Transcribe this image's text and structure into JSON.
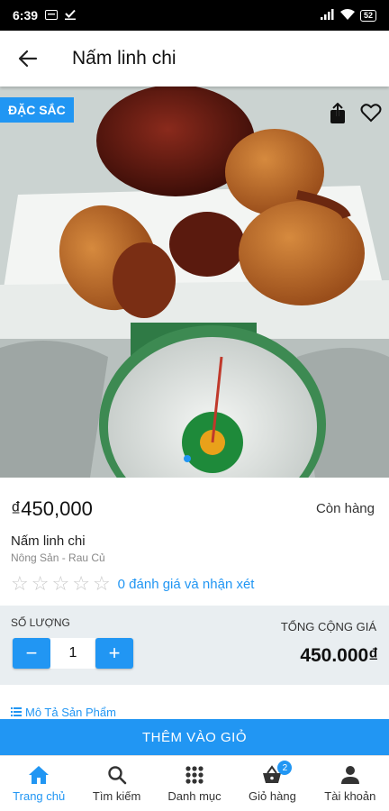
{
  "status_bar": {
    "time": "6:39",
    "battery": "52"
  },
  "app_bar": {
    "title": "Nấm linh chi"
  },
  "product": {
    "badge": "ĐẶC SẮC",
    "price": "₫450,000",
    "stock_status": "Còn hàng",
    "name": "Nấm linh chi",
    "category": "Nông Sản - Rau Củ",
    "rating": 0,
    "stars": [
      "☆",
      "☆",
      "☆",
      "☆",
      "☆"
    ],
    "reviews_label": "0 đánh giá và nhận xét",
    "image_icon": "lingzhi-mushroom-photo"
  },
  "purchase": {
    "quantity_label": "SỐ LƯỢNG",
    "quantity": "1",
    "minus_label": "−",
    "plus_label": "+",
    "total_label": "TỔNG CỘNG GIÁ",
    "total_value": "450.000₫"
  },
  "description_tab": {
    "icon": "list-icon",
    "label": "Mô Tả Sản Phẩm"
  },
  "add_to_cart_label": "THÊM VÀO GIỎ",
  "bottom_nav": {
    "items": [
      {
        "label": "Trang chủ",
        "icon": "home-icon"
      },
      {
        "label": "Tìm kiếm",
        "icon": "search-icon"
      },
      {
        "label": "Danh mục",
        "icon": "grid-icon"
      },
      {
        "label": "Giỏ hàng",
        "icon": "basket-icon",
        "badge": "2"
      },
      {
        "label": "Tài khoản",
        "icon": "user-icon"
      }
    ],
    "active_index": 0
  },
  "colors": {
    "accent": "#2196f3",
    "panel": "#e9eef1"
  }
}
